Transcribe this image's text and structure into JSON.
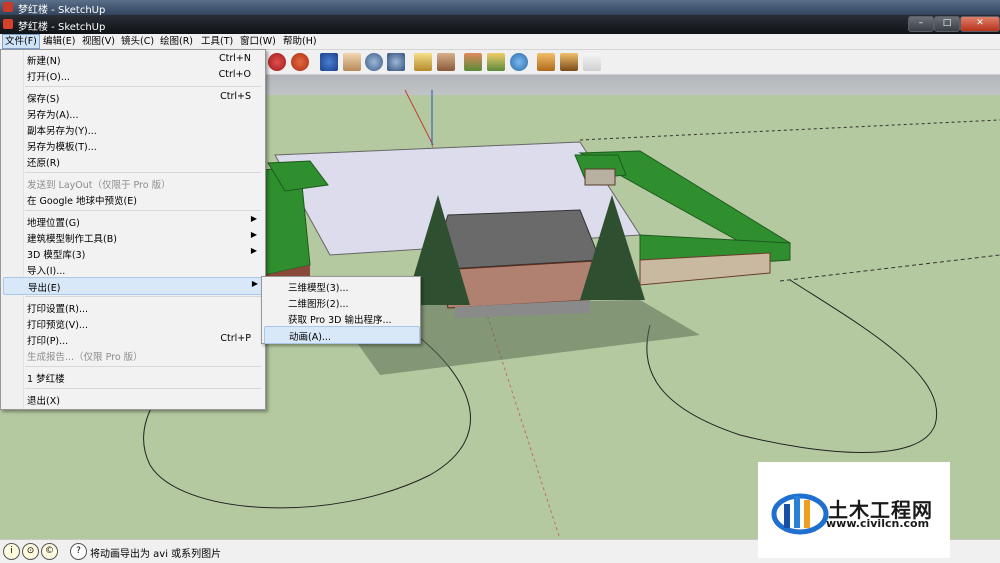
{
  "back_window": {
    "title": "梦红楼 - SketchUp"
  },
  "window": {
    "title": "梦红楼 - SketchUp",
    "controls": [
      "–",
      "□",
      "✕"
    ]
  },
  "menubar": [
    "文件(F)",
    "编辑(E)",
    "视图(V)",
    "镜头(C)",
    "绘图(R)",
    "工具(T)",
    "窗口(W)",
    "帮助(H)"
  ],
  "file_menu": [
    {
      "label": "新建(N)",
      "shortcut": "Ctrl+N"
    },
    {
      "label": "打开(O)...",
      "shortcut": "Ctrl+O"
    },
    {
      "label": "保存(S)",
      "shortcut": "Ctrl+S"
    },
    {
      "label": "另存为(A)...",
      "shortcut": ""
    },
    {
      "label": "副本另存为(Y)...",
      "shortcut": ""
    },
    {
      "label": "另存为模板(T)...",
      "shortcut": ""
    },
    {
      "label": "还原(R)",
      "shortcut": ""
    },
    {
      "label": "发送到 LayOut（仅限于 Pro 版）",
      "shortcut": ""
    },
    {
      "label": "在 Google 地球中预览(E)",
      "shortcut": ""
    },
    {
      "label": "地理位置(G)",
      "shortcut": ""
    },
    {
      "label": "建筑模型制作工具(B)",
      "shortcut": ""
    },
    {
      "label": "3D 模型库(3)",
      "shortcut": ""
    },
    {
      "label": "导入(I)...",
      "shortcut": ""
    },
    {
      "label": "导出(E)",
      "shortcut": ""
    },
    {
      "label": "打印设置(R)...",
      "shortcut": ""
    },
    {
      "label": "打印预览(V)...",
      "shortcut": ""
    },
    {
      "label": "打印(P)...",
      "shortcut": "Ctrl+P"
    },
    {
      "label": "生成报告...（仅限 Pro 版）",
      "shortcut": ""
    },
    {
      "label": "1 梦红楼",
      "shortcut": ""
    },
    {
      "label": "退出(X)",
      "shortcut": ""
    }
  ],
  "export_submenu": [
    "三维模型(3)...",
    "二维图形(2)...",
    "获取 Pro 3D 输出程序...",
    "动画(A)..."
  ],
  "status": {
    "message": "将动画导出为 avi 或系列图片",
    "icons": [
      "info-icon",
      "location-icon",
      "credits-icon",
      "help-icon"
    ]
  },
  "watermark": {
    "title": "土木工程网",
    "url": "www.civilcn.com"
  },
  "colors": {
    "ground": "#b4c9a0",
    "sky": "#b7bbbf",
    "roof_green": "#2f8f2f",
    "menu_highlight": "#d9e8f8"
  }
}
